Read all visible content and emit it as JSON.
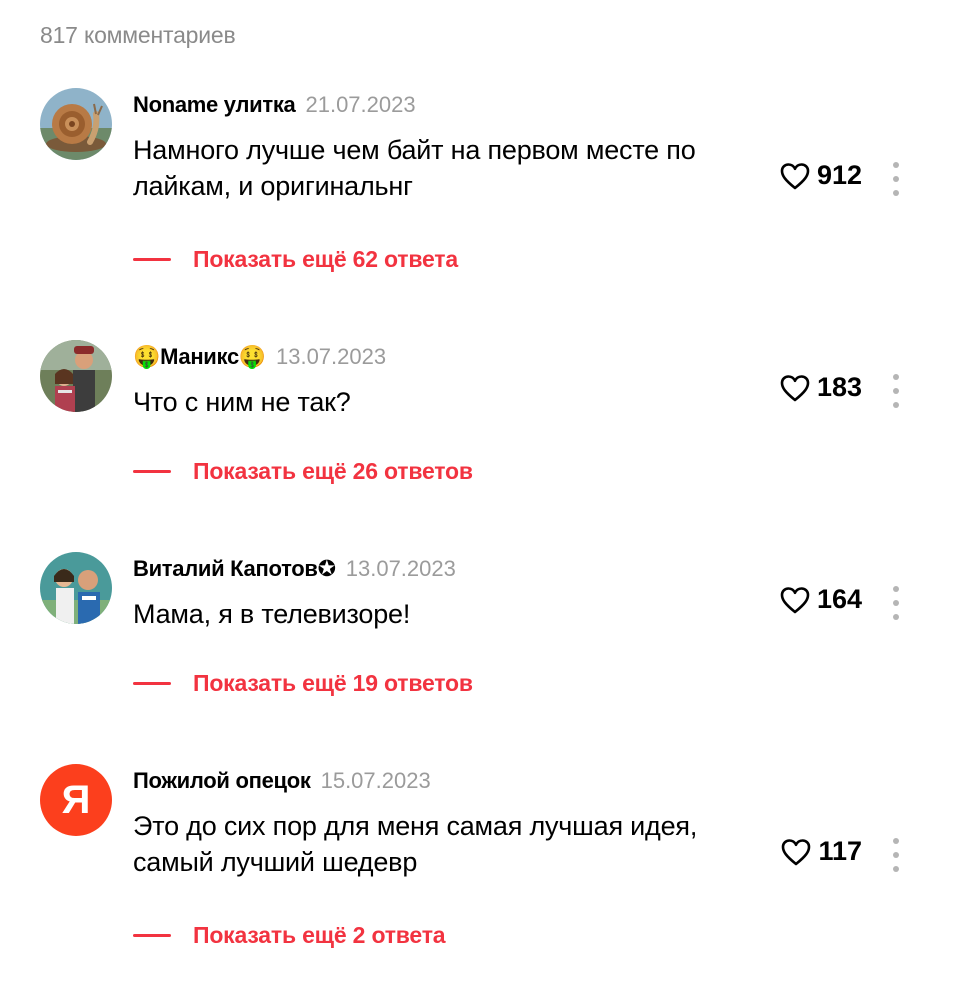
{
  "comments_count": "817 комментариев",
  "colors": {
    "accent": "#f23340",
    "muted": "#9b9b9b",
    "yandex_red": "#fc3f1d"
  },
  "comments": [
    {
      "author": "Noname улитка",
      "date": "21.07.2023",
      "text": "Намного лучше чем байт на первом месте по лайкам, и оригинальнг",
      "likes": "912",
      "replies_label": "Показать ещё 62 ответа",
      "avatar": "snail-avatar"
    },
    {
      "author": "🤑Маникс🤑",
      "date": "13.07.2023",
      "text": "Что с ним не так?",
      "likes": "183",
      "replies_label": "Показать ещё 26 ответов",
      "avatar": "photo-avatar"
    },
    {
      "author": "Виталий Капотов✪",
      "date": "13.07.2023",
      "text": "Мама, я в телевизоре!",
      "likes": "164",
      "replies_label": "Показать ещё 19 ответов",
      "avatar": "photo-avatar"
    },
    {
      "author": "Пожилой опецок",
      "date": "15.07.2023",
      "text": "Это до сих пор для меня самая лучшая идея, самый лучший шедевр",
      "likes": "117",
      "replies_label": "Показать ещё 2 ответа",
      "avatar": "yandex-avatar",
      "avatar_letter": "Я"
    }
  ]
}
